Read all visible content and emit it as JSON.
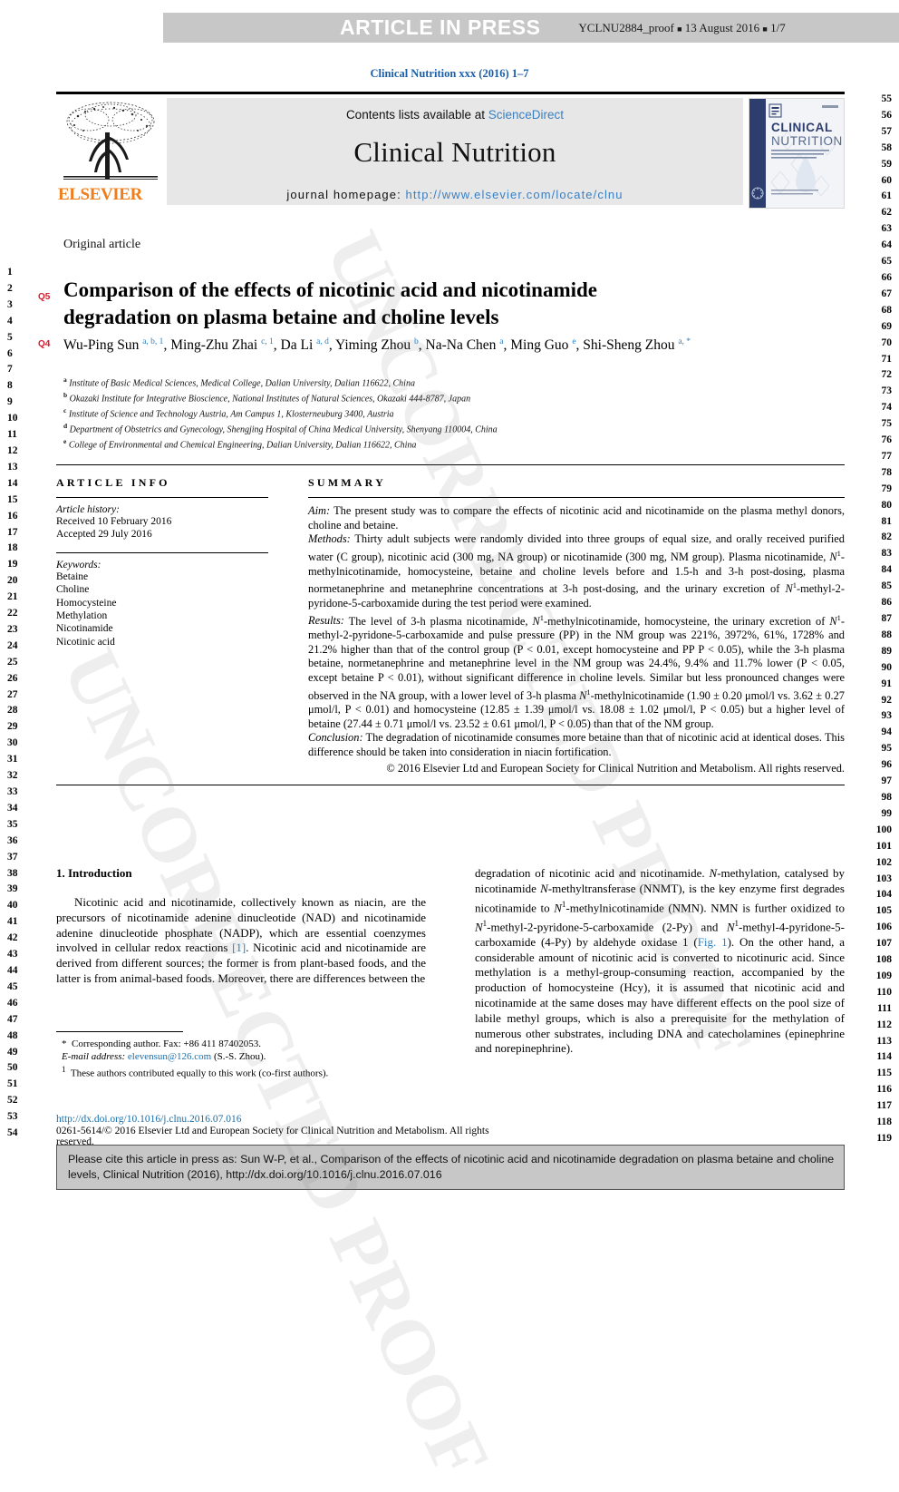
{
  "header": {
    "article_in_press": "ARTICLE IN PRESS",
    "proof_id": "YCLNU2884_proof",
    "proof_date": "13 August 2016",
    "proof_pages": "1/7"
  },
  "journal_ref": "Clinical Nutrition xxx (2016) 1–7",
  "masthead": {
    "contents_prefix": "Contents lists available at ",
    "contents_link": "ScienceDirect",
    "journal_name": "Clinical Nutrition",
    "homepage_label": "journal homepage: ",
    "homepage_url": "http://www.elsevier.com/locate/clnu",
    "publisher": "ELSEVIER",
    "cover_title_line1": "CLINICAL",
    "cover_title_line2": "NUTRITION"
  },
  "article": {
    "type": "Original article",
    "title_line1": "Comparison of the effects of nicotinic acid and nicotinamide",
    "title_line2": "degradation on plasma betaine and choline levels",
    "query_marks": [
      "Q5",
      "Q4"
    ],
    "authors": [
      {
        "name": "Wu-Ping Sun",
        "marks": "a, b, 1"
      },
      {
        "name": "Ming-Zhu Zhai",
        "marks": "c, 1"
      },
      {
        "name": "Da Li",
        "marks": "a, d"
      },
      {
        "name": "Yiming Zhou",
        "marks": "b"
      },
      {
        "name": "Na-Na Chen",
        "marks": "a"
      },
      {
        "name": "Ming Guo",
        "marks": "e"
      },
      {
        "name": "Shi-Sheng Zhou",
        "marks": "a, *"
      }
    ],
    "affiliations": [
      {
        "mark": "a",
        "text": "Institute of Basic Medical Sciences, Medical College, Dalian University, Dalian 116622, China"
      },
      {
        "mark": "b",
        "text": "Okazaki Institute for Integrative Bioscience, National Institutes of Natural Sciences, Okazaki 444-8787, Japan"
      },
      {
        "mark": "c",
        "text": "Institute of Science and Technology Austria, Am Campus 1, Klosterneuburg 3400, Austria"
      },
      {
        "mark": "d",
        "text": "Department of Obstetrics and Gynecology, Shengjing Hospital of China Medical University, Shenyang 110004, China"
      },
      {
        "mark": "e",
        "text": "College of Environmental and Chemical Engineering, Dalian University, Dalian 116622, China"
      }
    ]
  },
  "article_info": {
    "heading": "ARTICLE INFO",
    "history_label": "Article history:",
    "history": [
      "Received 10 February 2016",
      "Accepted 29 July 2016"
    ],
    "keywords_label": "Keywords:",
    "keywords": [
      "Betaine",
      "Choline",
      "Homocysteine",
      "Methylation",
      "Nicotinamide",
      "Nicotinic acid"
    ]
  },
  "summary": {
    "heading": "SUMMARY",
    "aim_label": "Aim:",
    "aim_text": " The present study was to compare the effects of nicotinic acid and nicotinamide on the plasma methyl donors, choline and betaine.",
    "methods_label": "Methods:",
    "methods_text": " Thirty adult subjects were randomly divided into three groups of equal size, and orally received purified water (C group), nicotinic acid (300 mg, NA group) or nicotinamide (300 mg, NM group). Plasma nicotinamide, N1-methylnicotinamide, homocysteine, betaine and choline levels before and 1.5-h and 3-h post-dosing, plasma normetanephrine and metanephrine concentrations at 3-h post-dosing, and the urinary excretion of N1-methyl-2-pyridone-5-carboxamide during the test period were examined.",
    "results_label": "Results:",
    "results_text": " The level of 3-h plasma nicotinamide, N1-methylnicotinamide, homocysteine, the urinary excretion of N1-methyl-2-pyridone-5-carboxamide and pulse pressure (PP) in the NM group was 221%, 3972%, 61%, 1728% and 21.2% higher than that of the control group (P < 0.01, except homocysteine and PP P < 0.05), while the 3-h plasma betaine, normetanephrine and metanephrine level in the NM group was 24.4%, 9.4% and 11.7% lower (P < 0.05, except betaine P < 0.01), without significant difference in choline levels. Similar but less pronounced changes were observed in the NA group, with a lower level of 3-h plasma N1-methylnicotinamide (1.90 ± 0.20 μmol/l vs. 3.62 ± 0.27 μmol/l, P < 0.01) and homocysteine (12.85 ± 1.39 μmol/l vs. 18.08 ± 1.02 μmol/l, P < 0.05) but a higher level of betaine (27.44 ± 0.71 μmol/l vs. 23.52 ± 0.61 μmol/l, P < 0.05) than that of the NM group.",
    "conclusion_label": "Conclusion:",
    "conclusion_text": " The degradation of nicotinamide consumes more betaine than that of nicotinic acid at identical doses. This difference should be taken into consideration in niacin fortification.",
    "copyright": "© 2016 Elsevier Ltd and European Society for Clinical Nutrition and Metabolism. All rights reserved."
  },
  "introduction": {
    "heading": "1. Introduction",
    "left_paragraph": "Nicotinic acid and nicotinamide, collectively known as niacin, are the precursors of nicotinamide adenine dinucleotide (NAD) and nicotinamide adenine dinucleotide phosphate (NADP), which are essential coenzymes involved in cellular redox reactions [1]. Nicotinic acid and nicotinamide are derived from different sources; the former is from plant-based foods, and the latter is from animal-based foods. Moreover, there are differences between the",
    "right_paragraph": "degradation of nicotinic acid and nicotinamide. N-methylation, catalysed by nicotinamide N-methyltransferase (NNMT), is the key enzyme first degrades nicotinamide to N1-methylnicotinamide (NMN). NMN is further oxidized to N1-methyl-2-pyridone-5-carboxamide (2-Py) and N1-methyl-4-pyridone-5-carboxamide (4-Py) by aldehyde oxidase 1 (Fig. 1). On the other hand, a considerable amount of nicotinic acid is converted to nicotinuric acid. Since methylation is a methyl-group-consuming reaction, accompanied by the production of homocysteine (Hcy), it is assumed that nicotinic acid and nicotinamide at the same doses may have different effects on the pool size of labile methyl groups, which is also a prerequisite for the methylation of numerous other substrates, including DNA and catecholamines (epinephrine and norepinephrine).",
    "ref_link_1": "[1]",
    "fig_link": "Fig. 1"
  },
  "footnotes": {
    "corresponding": "Corresponding author. Fax: +86 411 87402053.",
    "email_label": "E-mail address:",
    "email": "elevensun@126.com",
    "email_suffix": " (S.-S. Zhou).",
    "equal_contrib_mark": "1",
    "equal_contrib": "These authors contributed equally to this work (co-first authors)."
  },
  "doi_block": {
    "doi_url": "http://dx.doi.org/10.1016/j.clnu.2016.07.016",
    "issn_line": "0261-5614/© 2016 Elsevier Ltd and European Society for Clinical Nutrition and Metabolism. All rights reserved."
  },
  "cite_box": {
    "text": "Please cite this article in press as: Sun W-P, et al., Comparison of the effects of nicotinic acid and nicotinamide degradation on plasma betaine and choline levels, Clinical Nutrition (2016), http://dx.doi.org/10.1016/j.clnu.2016.07.016"
  },
  "line_numbers": {
    "left_start": 1,
    "left_end": 54,
    "right_start": 55,
    "right_end": 119
  },
  "watermark": {
    "text": "UNCORRECTED PROOF"
  },
  "colors": {
    "link_blue": "#2b82c4",
    "ref_blue": "#1c5fa8",
    "elsevier_orange": "#ef7d1a",
    "query_red": "#d8192b",
    "bar_gray": "#c7c7c7",
    "masthead_gray": "#e7e7e7"
  }
}
